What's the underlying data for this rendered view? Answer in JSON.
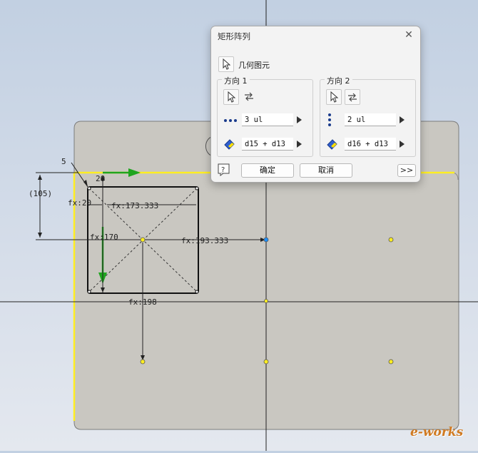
{
  "dialog": {
    "title": "矩形阵列",
    "geometry_label": "几何图元",
    "direction1": {
      "title": "方向 1",
      "count": "3 ul",
      "spacing": "d15 + d13"
    },
    "direction2": {
      "title": "方向 2",
      "count": "2 ul",
      "spacing": "d16 + d13"
    },
    "ok_label": "确定",
    "cancel_label": "取消",
    "more_label": ">>"
  },
  "sketch": {
    "dim_top_offset": "5",
    "dim_width": "20",
    "dim_height_driven": "(105)",
    "dim_left": "fx:20",
    "dim_inner_width": "fx:173.333",
    "dim_inner_height": "fx:170",
    "dim_h_spacing": "fx:193.333",
    "dim_v_spacing": "fx:198"
  },
  "watermark": "e-works",
  "colors": {
    "plate": "#c9c7c1",
    "highlight": "#ffee22",
    "accent_green": "#1fa51f",
    "dialog_bg": "#f3f3f3"
  }
}
